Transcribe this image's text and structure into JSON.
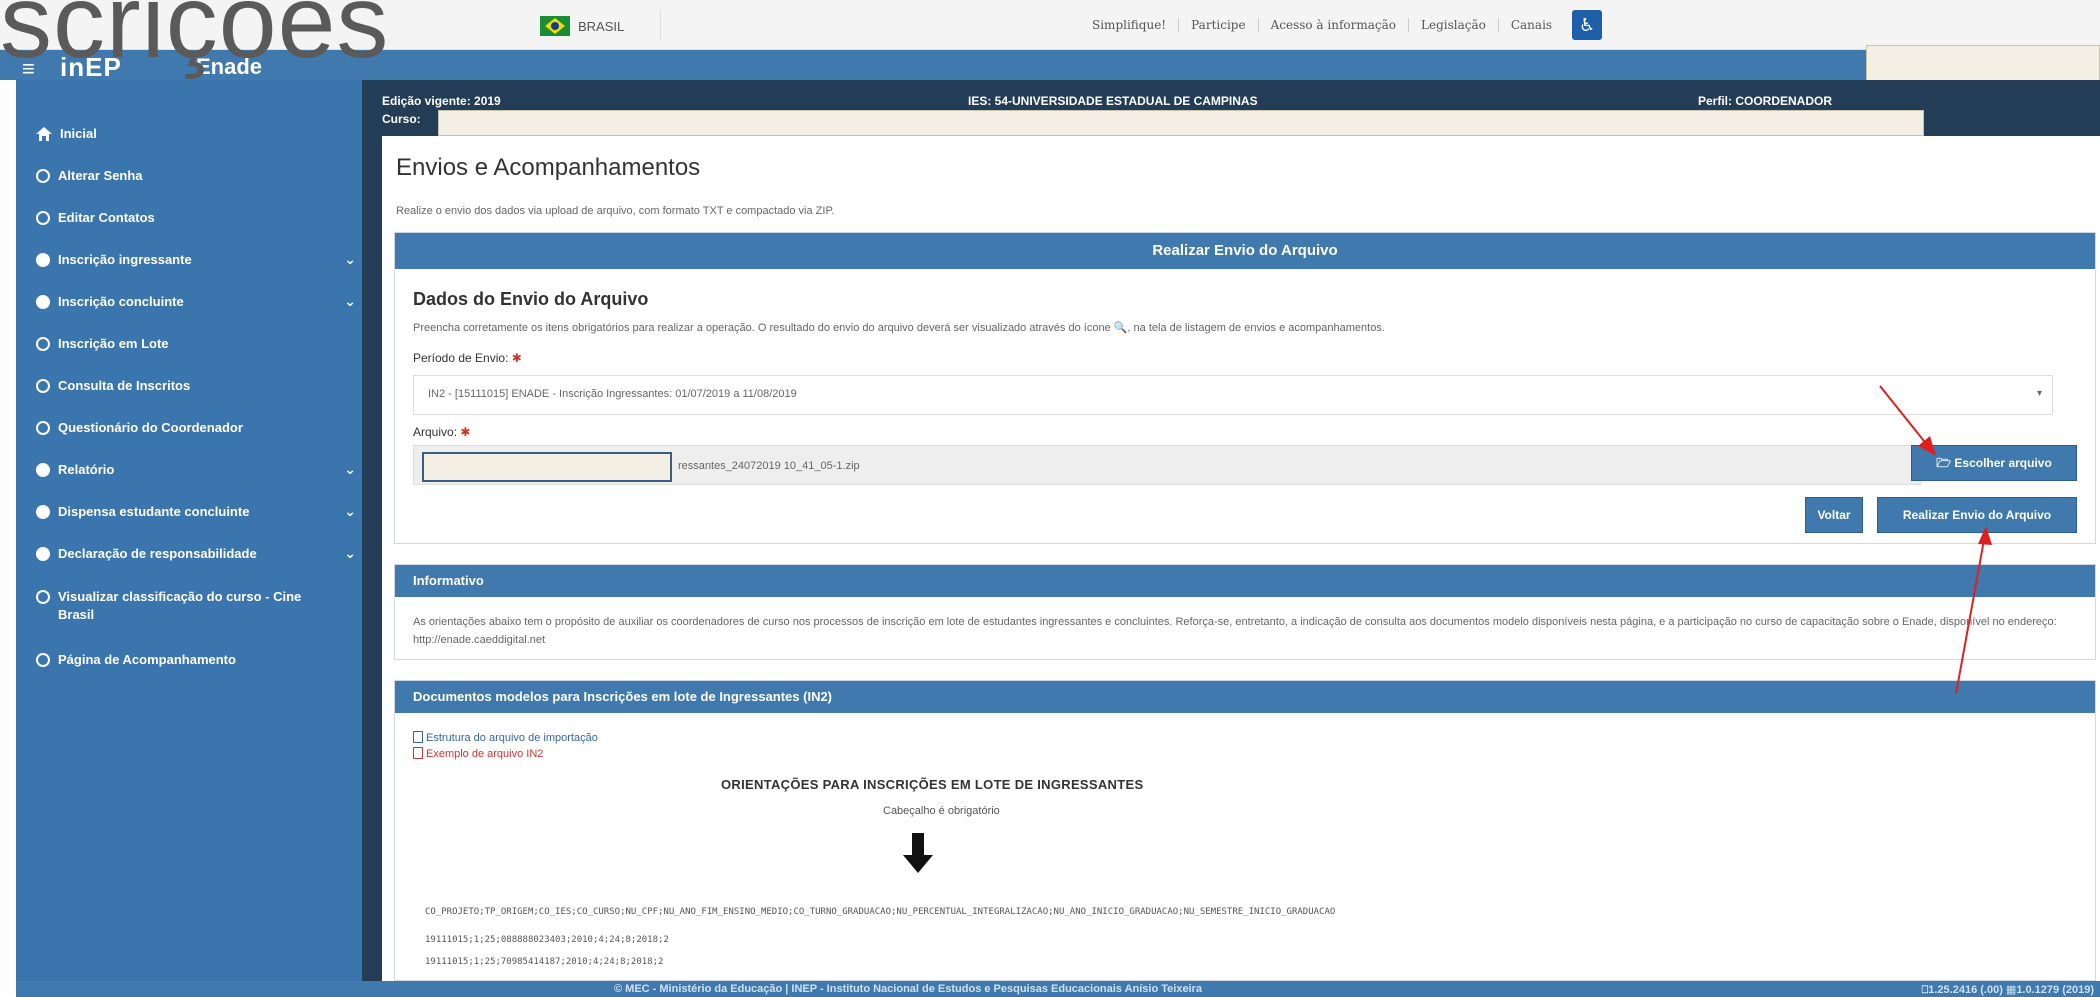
{
  "overlay_title": "scrições",
  "gov": {
    "brasil": "BRASIL",
    "links": [
      "Simplifique!",
      "Participe",
      "Acesso à informação",
      "Legislação",
      "Canais"
    ]
  },
  "app": {
    "logo_left": "inEP",
    "logo_right": "Enade"
  },
  "sidebar": {
    "items": [
      {
        "label": "Inicial",
        "icon": "home-icon",
        "chevron": false
      },
      {
        "label": "Alterar Senha",
        "icon": "circle-icon",
        "chevron": false
      },
      {
        "label": "Editar Contatos",
        "icon": "circle-icon",
        "chevron": false
      },
      {
        "label": "Inscrição ingressante",
        "icon": "circle-icon",
        "chevron": true
      },
      {
        "label": "Inscrição concluinte",
        "icon": "circle-icon",
        "chevron": true
      },
      {
        "label": "Inscrição em Lote",
        "icon": "circle-icon",
        "chevron": false
      },
      {
        "label": "Consulta de Inscritos",
        "icon": "circle-icon",
        "chevron": false
      },
      {
        "label": "Questionário do Coordenador",
        "icon": "circle-icon",
        "chevron": false
      },
      {
        "label": "Relatório",
        "icon": "circle-icon",
        "chevron": true
      },
      {
        "label": "Dispensa estudante concluinte",
        "icon": "circle-icon",
        "chevron": true
      },
      {
        "label": "Declaração de responsabilidade",
        "icon": "circle-icon",
        "chevron": true
      },
      {
        "label": "Visualizar classificação do curso - Cine Brasil",
        "icon": "circle-icon",
        "chevron": false
      },
      {
        "label": "Página de Acompanhamento",
        "icon": "circle-icon",
        "chevron": false
      }
    ]
  },
  "context": {
    "edicao": "Edição vigente: 2019",
    "curso": "Curso:",
    "ies": "IES: 54-UNIVERSIDADE ESTADUAL DE CAMPINAS",
    "perfil": "Perfil: COORDENADOR"
  },
  "main": {
    "title": "Envios e Acompanhamentos",
    "subtitle": "Realize o envio dos dados via upload de arquivo, com formato TXT e compactado via ZIP.",
    "envio_panel": {
      "header": "Realizar Envio do Arquivo",
      "section_title": "Dados do Envio do Arquivo",
      "description": "Preencha corretamente os itens obrigatórios para realizar a operação. O resultado do envio do arquivo deverá ser visualizado através do ícone 🔍, na tela de listagem de envios e acompanhamentos.",
      "periodo_label": "Período de Envio:",
      "periodo_value": "IN2 - [15111015] ENADE - Inscrição Ingressantes: 01/07/2019 a 11/08/2019",
      "arquivo_label": "Arquivo:",
      "arquivo_value": "ressantes_24072019 10_41_05-1.zip",
      "btn_escolher": "🗁 Escolher arquivo",
      "btn_voltar": "Voltar",
      "btn_realizar": "Realizar Envio do Arquivo"
    },
    "info_panel": {
      "header": "Informativo",
      "text": "As orientações abaixo tem o propósito de auxiliar os coordenadores de curso nos processos de inscrição em lote de estudantes ingressantes e concluintes. Reforça-se, entretanto, a indicação de consulta aos documentos modelo disponíveis nesta página, e a participação no curso de capacitação sobre o Enade, disponível no endereço: http://enade.caeddigital.net"
    },
    "docs_panel": {
      "header": "Documentos modelos para Inscrições em lote de Ingressantes (IN2)",
      "link1": "Estrutura do arquivo de importação",
      "link2": "Exemplo de arquivo IN2",
      "orient_title": "ORIENTAÇÕES PARA INSCRIÇÕES EM LOTE DE INGRESSANTES",
      "orient_sub": "Cabeçalho é obrigatório",
      "code_lines": [
        "CO_PROJETO;TP_ORIGEM;CO_IES;CO_CURSO;NU_CPF;NU_ANO_FIM_ENSINO_MEDIO;CO_TURNO_GRADUACAO;NU_PERCENTUAL_INTEGRALIZACAO;NU_ANO_INICIO_GRADUACAO;NU_SEMESTRE_INICIO_GRADUACAO",
        "19111015;1;25;088888023403;2010;4;24;8;2018;2",
        "19111015;1;25;70985414187;2010;4;24;8;2018;2"
      ]
    }
  },
  "footer": {
    "text": "© MEC - Ministério da Educação | INEP - Instituto Nacional de Estudos e Pesquisas Educacionais Anísio Teixeira",
    "version": "⎕1.25.2416 (.00) ▦1.0.1279 (2019)"
  },
  "colors": {
    "primary": "#3f79ad",
    "dark": "#233d57",
    "arrow": "#e02020"
  }
}
